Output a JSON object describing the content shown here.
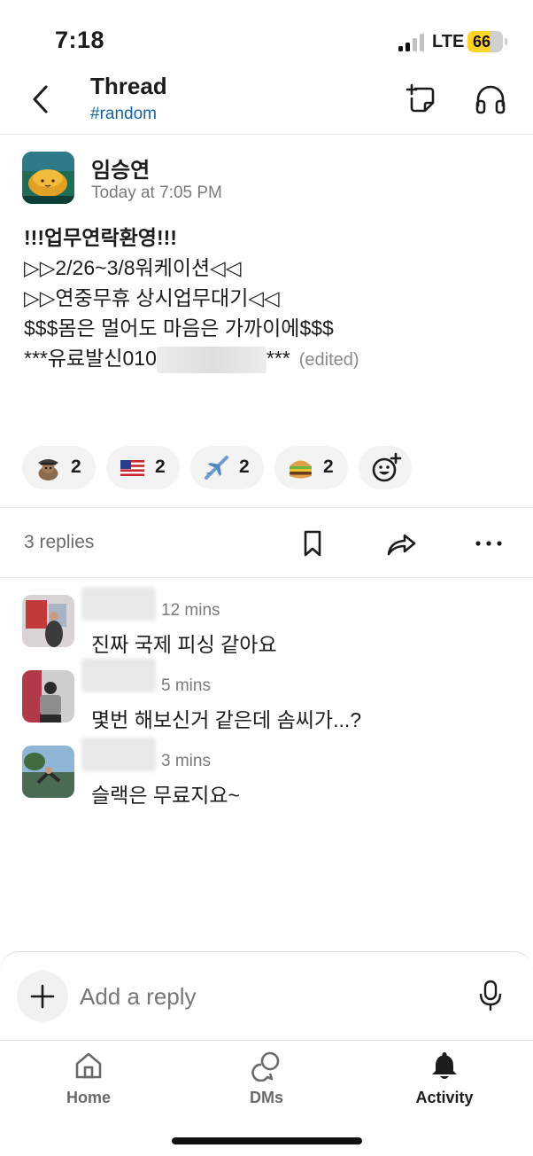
{
  "status_bar": {
    "time": "7:18",
    "network": "LTE",
    "battery": "66",
    "battery_level": 0.66
  },
  "header": {
    "title": "Thread",
    "channel": "#random"
  },
  "message": {
    "author": "임승연",
    "timestamp": "Today at 7:05 PM",
    "lines": [
      "!!!업무연락환영!!!",
      "",
      "▷▷2/26~3/8워케이션◁◁",
      "▷▷연중무휴 상시업무대기◁◁",
      "",
      "$$$몸은 멀어도 마음은 가까이에$$$"
    ],
    "last_line_prefix": "***유료발신010",
    "last_line_suffix": "***",
    "edited": "(edited)"
  },
  "reactions": [
    {
      "emoji": "detective-squirrel-emoji",
      "count": "2"
    },
    {
      "emoji": "us-flag-emoji",
      "count": "2"
    },
    {
      "emoji": "airplane-emoji",
      "count": "2"
    },
    {
      "emoji": "hamburger-emoji",
      "count": "2"
    }
  ],
  "replies_bar": {
    "count_label": "3 replies"
  },
  "replies": [
    {
      "time": "12 mins",
      "text": "진짜 국제 피싱 같아요"
    },
    {
      "time": "5 mins",
      "text": "몇번 해보신거 같은데 솜씨가...?"
    },
    {
      "time": "3 mins",
      "text": "슬랙은 무료지요~"
    }
  ],
  "composer": {
    "placeholder": "Add a reply"
  },
  "tabs": [
    {
      "label": "Home",
      "icon": "home-icon"
    },
    {
      "label": "DMs",
      "icon": "dms-icon"
    },
    {
      "label": "Activity",
      "icon": "bell-icon"
    }
  ],
  "colors": {
    "link": "#1264a3",
    "battery": "#ffd426",
    "muted": "#7a7a7a"
  }
}
